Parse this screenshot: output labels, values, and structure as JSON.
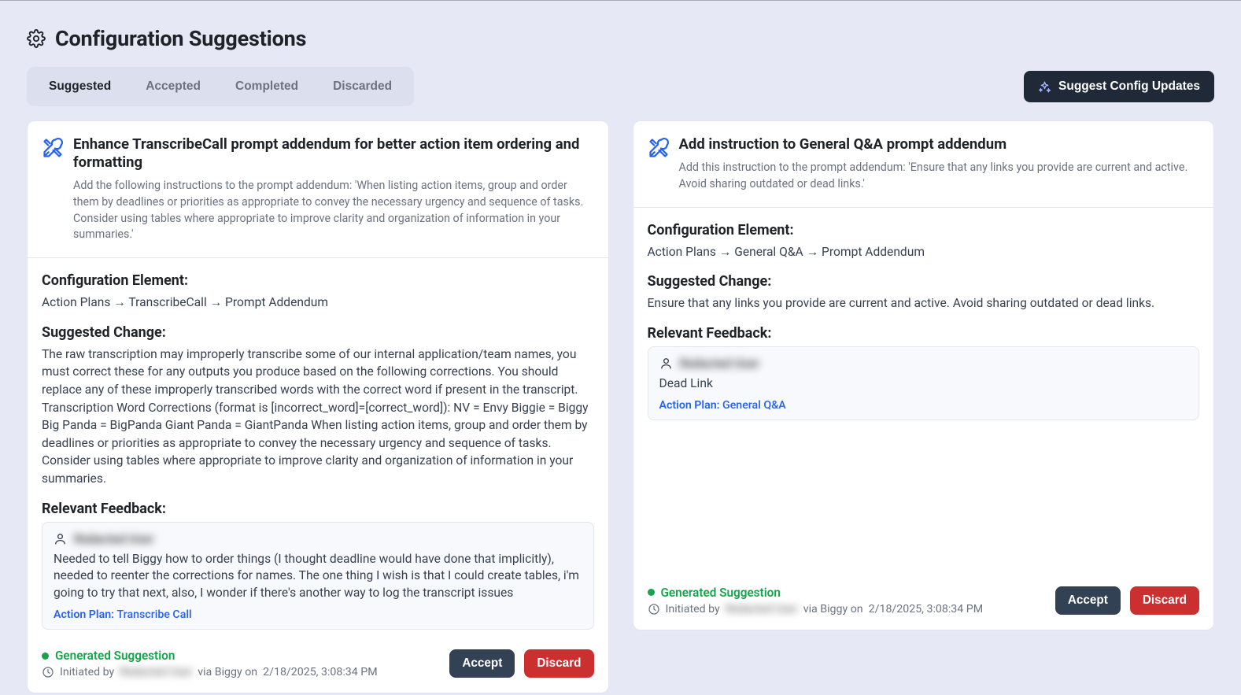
{
  "page": {
    "title": "Configuration Suggestions"
  },
  "tabs": {
    "suggested": "Suggested",
    "accepted": "Accepted",
    "completed": "Completed",
    "discarded": "Discarded"
  },
  "actions": {
    "suggest_updates": "Suggest Config Updates"
  },
  "labels": {
    "config_element": "Configuration Element:",
    "suggested_change": "Suggested Change:",
    "relevant_feedback": "Relevant Feedback:",
    "action_plan": "Action Plan:",
    "generated_suggestion": "Generated Suggestion",
    "initiated_by": "Initiated by",
    "via": "via Biggy on",
    "accept": "Accept",
    "discard": "Discard"
  },
  "cards": [
    {
      "title": "Enhance TranscribeCall prompt addendum for better action item ordering and formatting",
      "subtitle": "Add the following instructions to the prompt addendum: 'When listing action items, group and order them by deadlines or priorities as appropriate to convey the necessary urgency and sequence of tasks. Consider using tables where appropriate to improve clarity and organization of information in your summaries.'",
      "config_path": "Action Plans → TranscribeCall → Prompt Addendum",
      "change_text": "The raw transcription may improperly transcribe some of our internal application/team names, you must correct these for any outputs you produce based on the following corrections. You should replace any of these improperly transcribed words with the correct word if present in the transcript. Transcription Word Corrections (format is [incorrect_word]=[correct_word]): NV = Envy Biggie = Biggy Big Panda = BigPanda Giant Panda = GiantPanda When listing action items, group and order them by deadlines or priorities as appropriate to convey the necessary urgency and sequence of tasks. Consider using tables where appropriate to improve clarity and organization of information in your summaries.",
      "feedback": {
        "user": "Redacted User",
        "body": "Needed to tell Biggy how to order things (I thought deadline would have done that implicitly), needed to reenter the corrections for names. The one thing I wish is that I could create tables, i'm going to try that next, also, I wonder if there's another way to log the transcript issues",
        "plan": "Transcribe Call"
      },
      "initiator": "Redacted User",
      "timestamp": "2/18/2025, 3:08:34 PM"
    },
    {
      "title": "Add instruction to General Q&A prompt addendum",
      "subtitle": "Add this instruction to the prompt addendum: 'Ensure that any links you provide are current and active. Avoid sharing outdated or dead links.'",
      "config_path": "Action Plans → General Q&A → Prompt Addendum",
      "change_text": "Ensure that any links you provide are current and active. Avoid sharing outdated or dead links.",
      "feedback": {
        "user": "Redacted User",
        "body": "Dead Link",
        "plan": "General Q&A"
      },
      "initiator": "Redacted User",
      "timestamp": "2/18/2025, 3:08:34 PM"
    }
  ]
}
